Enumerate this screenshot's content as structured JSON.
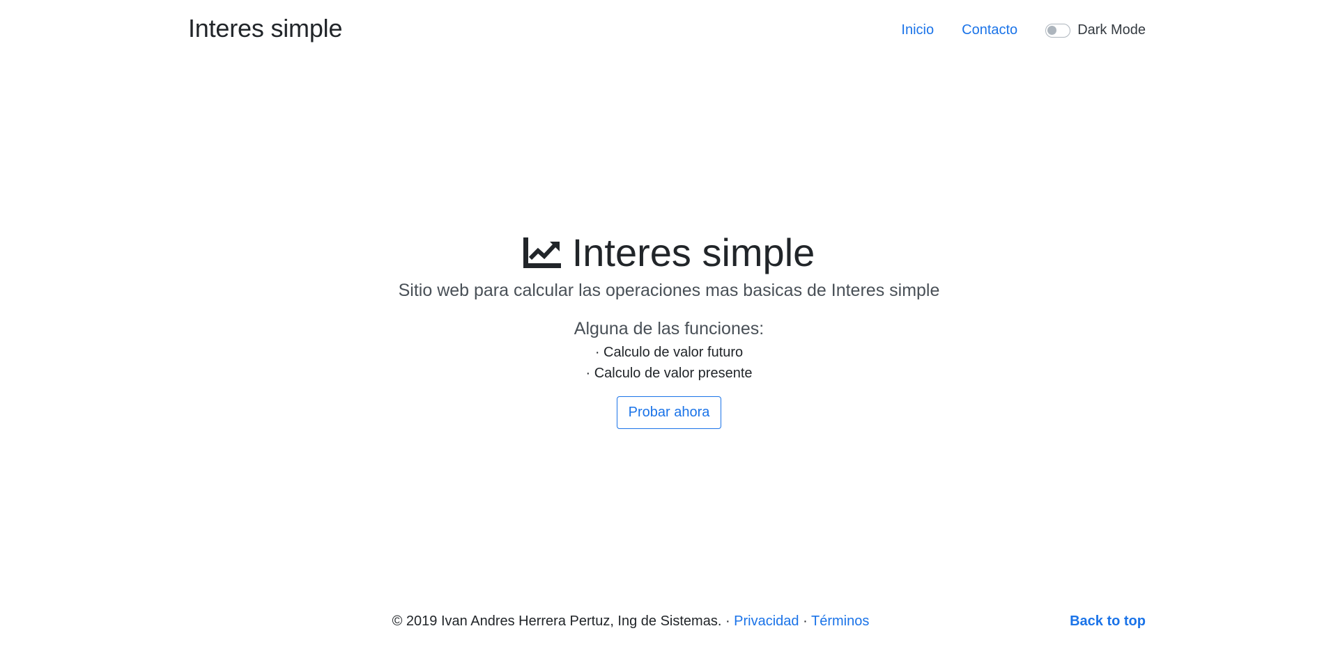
{
  "header": {
    "brand": "Interes simple",
    "nav": {
      "inicio": "Inicio",
      "contacto": "Contacto",
      "dark_mode": "Dark Mode"
    }
  },
  "hero": {
    "icon": "chart-line-icon",
    "title": "Interes simple",
    "lead": "Sitio web para calcular las operaciones mas basicas de Interes simple",
    "features_title": "Alguna de las funciones:",
    "features": [
      "· Calculo de valor futuro",
      "· Calculo de valor presente"
    ],
    "cta": "Probar ahora"
  },
  "footer": {
    "copyright": "© 2019 Ivan Andres Herrera Pertuz, Ing de Sistemas. · ",
    "privacidad": "Privacidad",
    "separator": " · ",
    "terminos": "Términos",
    "back_to_top": "Back to top"
  },
  "colors": {
    "link": "#1a73e8",
    "text": "#212529"
  }
}
